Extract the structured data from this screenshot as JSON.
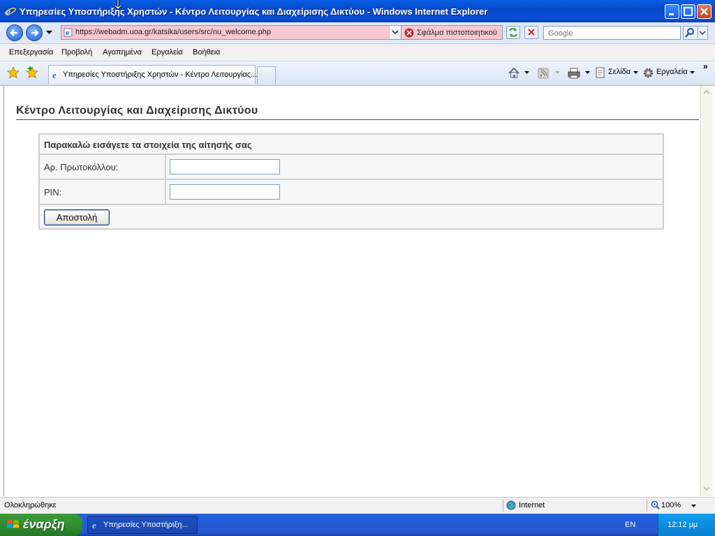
{
  "window": {
    "title": "Υπηρεσίες Υποστήριξης Χρηστών - Κέντρο Λειτουργίας και Διαχείρισης Δικτύου - Windows Internet Explorer"
  },
  "address_bar": {
    "url": "https://webadm.uoa.gr/katsika/users/src/nu_welcome.php",
    "cert_error": "Σφάλμα πιστοποιητικού"
  },
  "search": {
    "placeholder": "Google"
  },
  "menu": [
    "Επεξεργασία",
    "Προβολή",
    "Αγαπημένα",
    "Εργαλεία",
    "Βοήθεια"
  ],
  "tabs": [
    {
      "label": "Υπηρεσίες Υποστήριξης Χρηστών - Κέντρο Λειτουργίας..."
    }
  ],
  "toolbar": {
    "page_label": "Σελίδα",
    "tools_label": "Εργαλεία"
  },
  "page": {
    "heading": "Κέντρο Λειτουργίας και Διαχείρισης Δικτύου",
    "form": {
      "title": "Παρακαλώ εισάγετε τα στοιχεία της αίτησής σας",
      "protocol_label": "Αρ. Πρωτοκόλλου:",
      "protocol_value": "",
      "pin_label": "PIN:",
      "pin_value": "",
      "submit_label": "Αποστολή"
    }
  },
  "status_bar": {
    "status": "Ολοκληρώθηκε",
    "zone": "Internet",
    "zoom": "100%"
  },
  "taskbar": {
    "start_label": "έναρξη",
    "task_label": "Υπηρεσίες Υποστήριξη...",
    "language": "EN",
    "clock": "12:12 μμ"
  },
  "colors": {
    "titlebar": "#0a5ee6",
    "address_error_bg": "#f7c8d0",
    "heading_rule": "#2a4a7a",
    "start_green": "#2f8a2f"
  }
}
